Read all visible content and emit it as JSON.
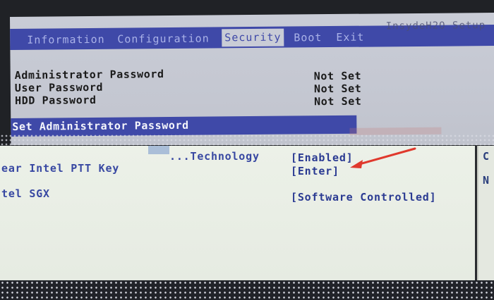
{
  "top": {
    "brand": "InsydeH2O Setup",
    "tabs": [
      {
        "label": "Information",
        "active": false
      },
      {
        "label": "Configuration",
        "active": false
      },
      {
        "label": "Security",
        "active": true
      },
      {
        "label": "Boot",
        "active": false
      },
      {
        "label": "Exit",
        "active": false
      }
    ],
    "rows": [
      {
        "label": "Administrator Password",
        "value": "Not Set"
      },
      {
        "label": "User Password",
        "value": "Not Set"
      },
      {
        "label": "HDD Password",
        "value": "Not Set"
      }
    ],
    "selected_item": "Set Administrator Password"
  },
  "bottom": {
    "rows": [
      {
        "label": "...Technology",
        "value": "[Enabled]"
      },
      {
        "label": "ear Intel PTT Key",
        "value": "[Enter]"
      },
      {
        "label": "tel SGX",
        "value": "[Software Controlled]"
      }
    ],
    "side_chars": [
      "C",
      "N"
    ]
  },
  "colors": {
    "menubar": "#3f49a8",
    "highlight": "#3f49a8",
    "arrow": "#e0392d",
    "value_text": "#2a3a92"
  }
}
